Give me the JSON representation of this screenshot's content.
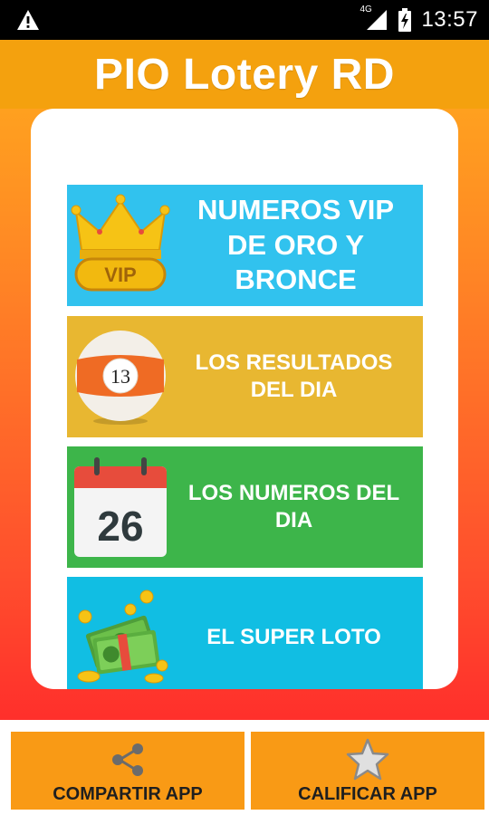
{
  "status_bar": {
    "time": "13:57",
    "network": "4G",
    "icons": [
      "warning-icon",
      "signal-icon",
      "battery-charging-icon"
    ]
  },
  "app": {
    "title": "PIO Lotery RD"
  },
  "menu": {
    "items": [
      {
        "label": "NUMEROS VIP DE ORO Y BRONCE",
        "icon": "vip-crown-icon",
        "color": "#31c2ee",
        "badge": "VIP"
      },
      {
        "label": "LOS RESULTADOS DEL DIA",
        "icon": "lottery-ball-icon",
        "color": "#e8b731",
        "ball_number": "13"
      },
      {
        "label": "LOS NUMEROS DEL DIA",
        "icon": "calendar-icon",
        "color": "#3db54a",
        "calendar_day": "26"
      },
      {
        "label": "EL SUPER LOTO",
        "icon": "money-coins-icon",
        "color": "#11bee3"
      }
    ]
  },
  "bottom_actions": {
    "share_label": "COMPARTIR APP",
    "rate_label": "CALIFICAR APP",
    "button_color": "#f99a15"
  }
}
